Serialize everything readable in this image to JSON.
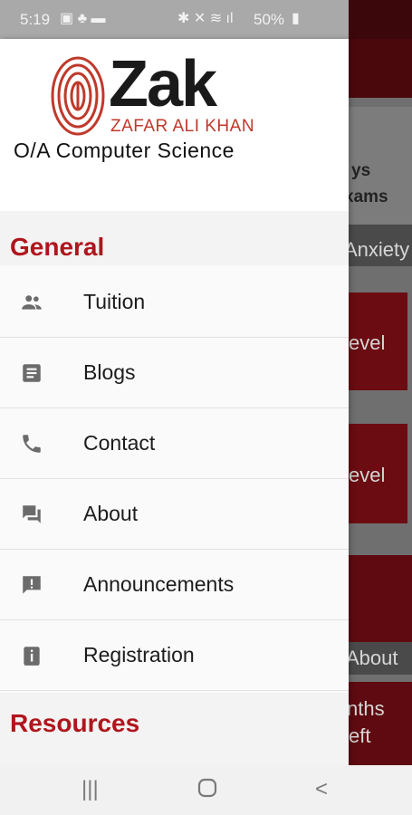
{
  "status": {
    "time": "5:19",
    "battery": "50%"
  },
  "app": {
    "logo_word": "Zak",
    "logo_sub": "ZAFAR ALI KHAN",
    "logo_tag": "O/A Computer Science"
  },
  "sections": {
    "general": "General",
    "resources": "Resources"
  },
  "menu": [
    {
      "label": "Tuition",
      "icon": "people-icon"
    },
    {
      "label": "Blogs",
      "icon": "article-icon"
    },
    {
      "label": "Contact",
      "icon": "phone-icon"
    },
    {
      "label": "About",
      "icon": "forum-icon"
    },
    {
      "label": "Announcements",
      "icon": "announcement-icon"
    },
    {
      "label": "Registration",
      "icon": "info-icon"
    }
  ],
  "background": {
    "text_1": "ys",
    "text_2": "xams",
    "text_3": "Anxiety",
    "text_4": "evel",
    "text_5": "evel",
    "text_6": "About",
    "text_7": "nths",
    "text_8": "eft"
  },
  "colors": {
    "accent": "#b0151d",
    "drawer_bg": "#fafafa"
  }
}
